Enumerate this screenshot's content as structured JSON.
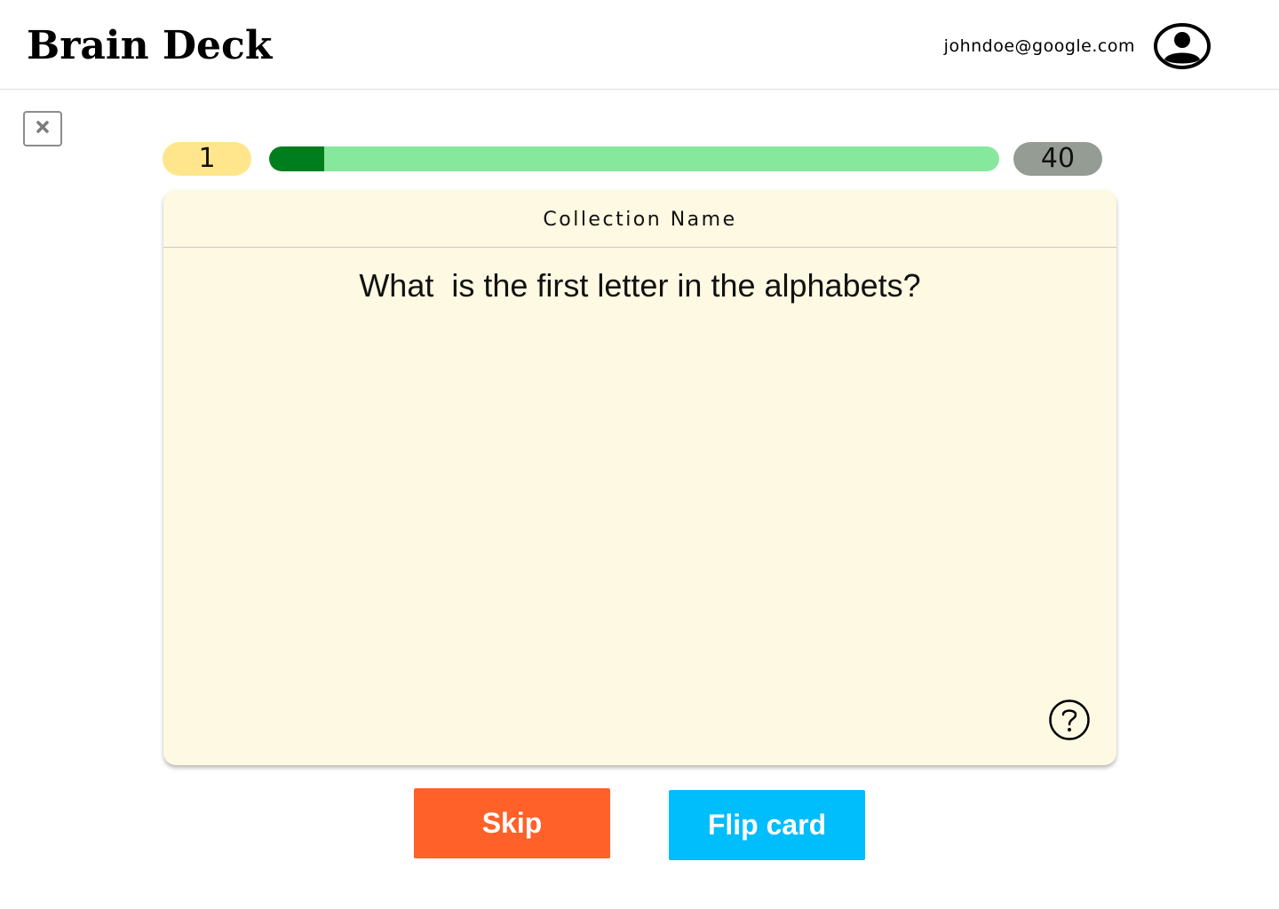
{
  "header": {
    "logo": "Brain Deck",
    "user_email": "johndoe@google.com",
    "avatar_icon": "user-circle-icon"
  },
  "close_button": {
    "icon": "close-icon"
  },
  "progress": {
    "current": "1",
    "total": "40",
    "fraction": 0.075,
    "colors": {
      "current_pill": "#ffe68c",
      "total_pill": "#949c94",
      "track": "#86e89c",
      "fill": "#007e1e"
    }
  },
  "card": {
    "collection_name": "Collection Name",
    "question": "What  is the first letter in the alphabets?",
    "help_icon": "question-circle-icon",
    "background": "#fef9e2"
  },
  "actions": {
    "skip_label": "Skip",
    "flip_label": "Flip card",
    "skip_color": "#ff6129",
    "flip_color": "#00bdfc"
  }
}
